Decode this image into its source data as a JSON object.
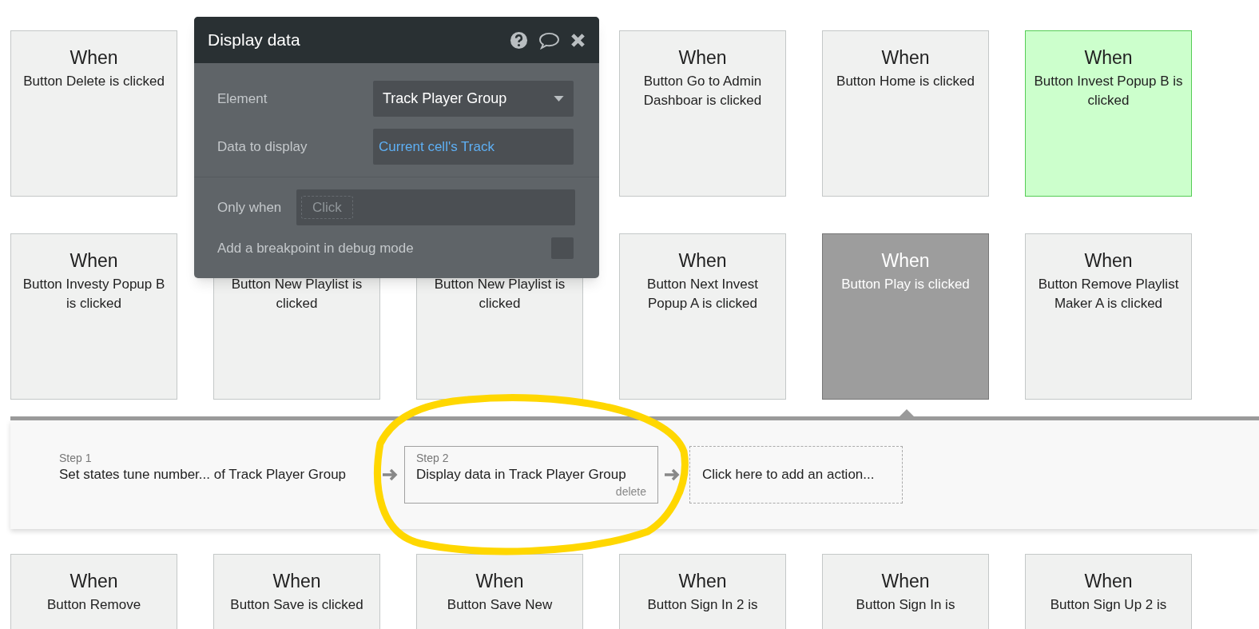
{
  "event_rows": [
    {
      "cards": [
        {
          "title": "When",
          "description": "Button Delete is clicked",
          "selected": false,
          "color": "#f0f1f0"
        },
        {
          "title": "When",
          "description": "Button Go to Admin Dashboar is clicked",
          "selected": false,
          "color": "#f0f1f0"
        },
        {
          "title": "When",
          "description": "Button Home is clicked",
          "selected": false,
          "color": "#f0f1f0"
        },
        {
          "title": "When",
          "description": "Button Invest Popup B is clicked",
          "selected": false,
          "color": "#ccffcc"
        }
      ]
    },
    {
      "cards": [
        {
          "title": "When",
          "description": "Button Investy Popup B is clicked",
          "selected": false,
          "color": "#f0f1f0"
        },
        {
          "description": "Button New Playlist is clicked",
          "selected": false,
          "color": "#f0f1f0"
        },
        {
          "description": "Button New Playlist is clicked",
          "selected": false,
          "color": "#f0f1f0"
        },
        {
          "title": "When",
          "description": "Button Next Invest Popup A is clicked",
          "selected": false,
          "color": "#f0f1f0"
        },
        {
          "title": "When",
          "description": "Button Play is clicked",
          "selected": true
        },
        {
          "title": "When",
          "description": "Button Remove Playlist Maker A is clicked",
          "selected": false,
          "color": "#f0f1f0"
        }
      ]
    }
  ],
  "workflow": {
    "steps": [
      {
        "kind": "step",
        "label": "Step 1",
        "text": "Set states tune number... of Track Player Group",
        "selected": false
      },
      {
        "kind": "step",
        "label": "Step 2",
        "text": "Display data in Track Player Group",
        "delete": "delete",
        "selected": true
      },
      {
        "kind": "add",
        "text": "Click here to add an action..."
      }
    ]
  },
  "bottom_row": {
    "cards": [
      {
        "title": "When",
        "description": "Button Remove",
        "selected": false,
        "color": "#f0f1f0"
      },
      {
        "title": "When",
        "description": "Button Save is clicked",
        "selected": false,
        "color": "#f0f1f0"
      },
      {
        "title": "When",
        "description": "Button Save New",
        "selected": false,
        "color": "#f0f1f0"
      },
      {
        "title": "When",
        "description": "Button Sign In 2 is",
        "selected": false,
        "color": "#f0f1f0"
      },
      {
        "title": "When",
        "description": "Button Sign In is",
        "selected": false,
        "color": "#f0f1f0"
      },
      {
        "title": "When",
        "description": "Button Sign Up 2 is",
        "selected": false,
        "color": "#f0f1f0"
      }
    ]
  },
  "popup": {
    "title": "Display data",
    "element_label": "Element",
    "element_value": "Track Player Group",
    "data_label": "Data to display",
    "data_value": "Current cell's Track",
    "only_when_label": "Only when",
    "only_when_placeholder": "Click",
    "breakpoint_label": "Add a breakpoint in debug mode",
    "breakpoint_checked": false
  }
}
